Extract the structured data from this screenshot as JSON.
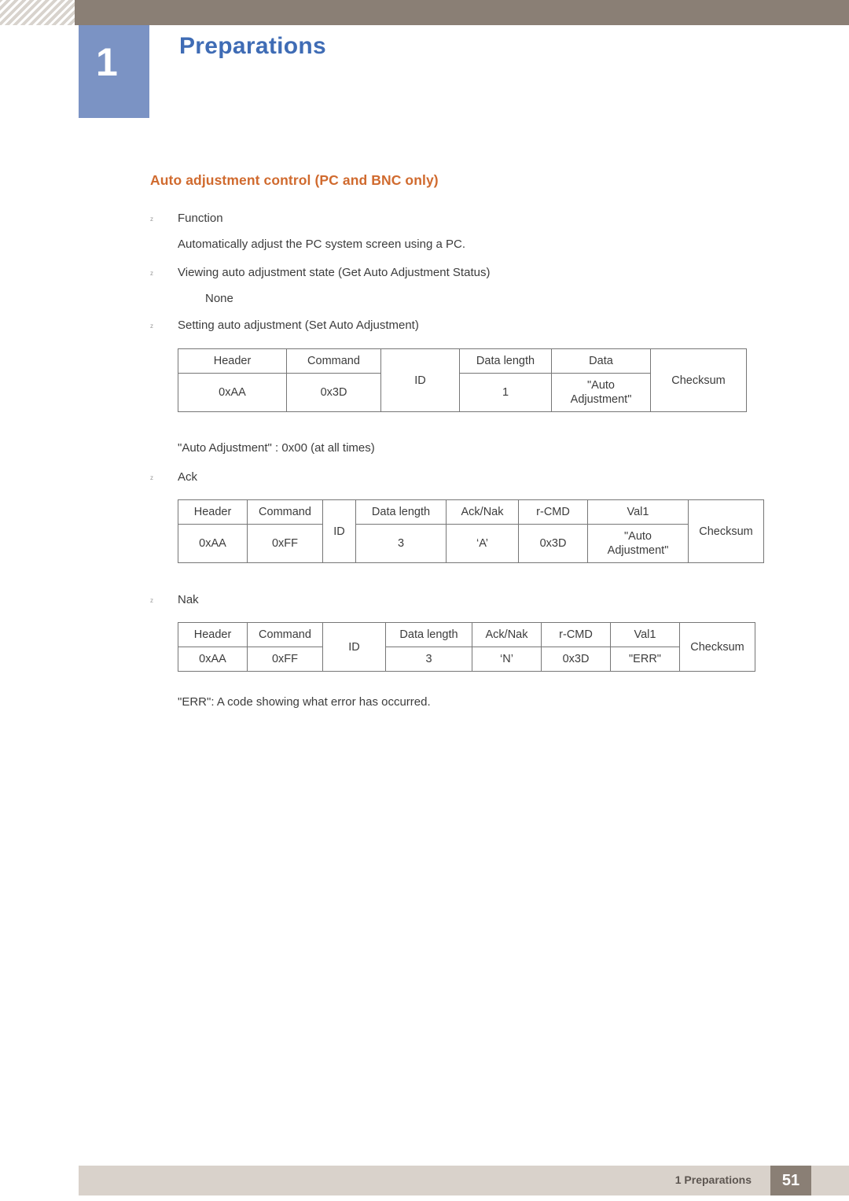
{
  "header": {
    "chapter_number": "1",
    "chapter_title": "Preparations"
  },
  "section": {
    "title": "Auto adjustment control (PC and BNC only)"
  },
  "bullets": {
    "function": "Function",
    "function_desc": "Automatically adjust the PC system screen using a PC.",
    "viewing_state": "Viewing auto adjustment state (Get Auto Adjustment Status)",
    "viewing_state_value": "None",
    "setting": "Setting auto adjustment (Set Auto Adjustment)",
    "auto_adjustment_note": "\"Auto Adjustment\" : 0x00 (at all times)",
    "ack": "Ack",
    "nak": "Nak",
    "err_note": "\"ERR\": A code showing what error has occurred."
  },
  "tables": {
    "set_auto_adjustment": {
      "headers": [
        "Header",
        "Command",
        "ID",
        "Data length",
        "Data",
        "Checksum"
      ],
      "values": [
        "0xAA",
        "0x3D",
        "ID",
        "1",
        "\"Auto Adjustment\"",
        "Checksum"
      ],
      "data_value_line1": "\"Auto",
      "data_value_line2": "Adjustment\""
    },
    "ack": {
      "headers": [
        "Header",
        "Command",
        "ID",
        "Data length",
        "Ack/Nak",
        "r-CMD",
        "Val1",
        "Checksum"
      ],
      "values": [
        "0xAA",
        "0xFF",
        "ID",
        "3",
        "‘A’",
        "0x3D",
        "\"Auto Adjustment\"",
        "Checksum"
      ],
      "val1_line1": "\"Auto",
      "val1_line2": "Adjustment\""
    },
    "nak": {
      "headers": [
        "Header",
        "Command",
        "ID",
        "Data length",
        "Ack/Nak",
        "r-CMD",
        "Val1",
        "Checksum"
      ],
      "values": [
        "0xAA",
        "0xFF",
        "ID",
        "3",
        "‘N’",
        "0x3D",
        "\"ERR\"",
        "Checksum"
      ]
    }
  },
  "footer": {
    "label": "1 Preparations",
    "page_number": "51"
  }
}
